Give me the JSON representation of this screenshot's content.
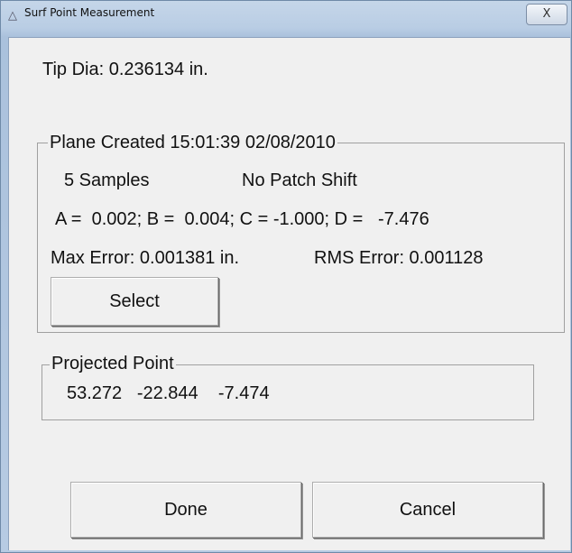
{
  "window": {
    "title": "Surf Point Measurement",
    "close_glyph": "X",
    "title_icon": "measure-icon"
  },
  "tip_dia": "Tip Dia: 0.236134 in.",
  "plane_group": {
    "title": "Plane Created 15:01:39 02/08/2010",
    "samples": "5 Samples",
    "patch_shift": "No Patch Shift",
    "coefficients": "A =  0.002; B =  0.004; C = -1.000; D =   -7.476",
    "max_error": "Max Error: 0.001381 in.",
    "rms_error": "RMS Error: 0.001128",
    "select_label": "Select"
  },
  "projected_group": {
    "title": "Projected Point",
    "values": "53.272   -22.844    -7.474"
  },
  "buttons": {
    "done_label": "Done",
    "cancel_label": "Cancel"
  }
}
